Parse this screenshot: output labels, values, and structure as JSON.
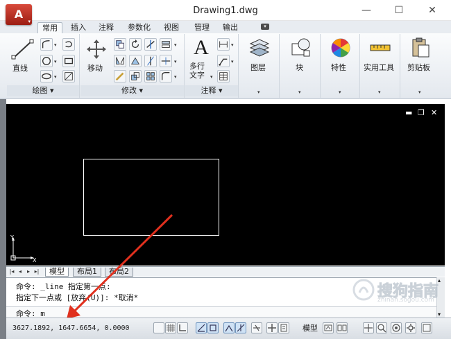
{
  "window": {
    "title": "Drawing1.dwg",
    "app_button": "A",
    "app_dropdown": "▾"
  },
  "ribbon_tabs": [
    "常用",
    "插入",
    "注释",
    "参数化",
    "视图",
    "管理",
    "输出"
  ],
  "ribbon_tab_active": "常用",
  "panels": {
    "draw": {
      "label": "绘图 ▾",
      "line_label": "直线"
    },
    "modify": {
      "label": "修改 ▾",
      "move_label": "移动"
    },
    "annotate": {
      "label": "注释 ▾",
      "mtext_label": "多行\n文字",
      "mtext_icon": "A"
    },
    "layer": {
      "label": "图层"
    },
    "block": {
      "label": "块"
    },
    "props": {
      "label": "特性"
    },
    "utils": {
      "label": "实用工具"
    },
    "clipboard": {
      "label": "剪贴板"
    }
  },
  "viewport": {
    "controls": {
      "min": "▬",
      "restore": "❐",
      "close": "✕"
    },
    "ucs_y": "Y",
    "ucs_x": "X"
  },
  "layout_tabs": [
    "模型",
    "布局1",
    "布局2"
  ],
  "layout_tab_active": "模型",
  "command_history": [
    "命令: _line 指定第一点:",
    "指定下一点或 [放弃(U)]: *取消*"
  ],
  "command_prompt": "命令: m",
  "status": {
    "coordinates": "3627.1892, 1647.6654, 0.0000",
    "model_label": "模型"
  },
  "watermark": {
    "text": "搜狗指南",
    "sub": "zhinan.sogou.com"
  },
  "colors": {
    "viewport_bg": "#000000",
    "arrow": "#e0301e",
    "app_button": "#c0392b"
  }
}
